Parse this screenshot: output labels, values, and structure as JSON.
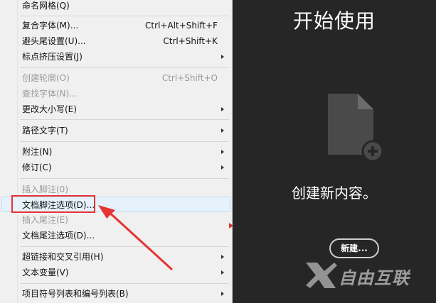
{
  "menu": {
    "items": [
      {
        "label": "命名网格(Q)",
        "shortcut": "",
        "submenu": false,
        "disabled": false
      },
      {
        "label": "复合字体(M)...",
        "shortcut": "Ctrl+Alt+Shift+F",
        "submenu": false,
        "disabled": false
      },
      {
        "label": "避头尾设置(U)...",
        "shortcut": "Ctrl+Shift+K",
        "submenu": false,
        "disabled": false
      },
      {
        "label": "标点挤压设置(J)",
        "shortcut": "",
        "submenu": true,
        "disabled": false
      },
      {
        "label": "创建轮廓(O)",
        "shortcut": "Ctrl+Shift+O",
        "submenu": false,
        "disabled": true
      },
      {
        "label": "查找字体(N)...",
        "shortcut": "",
        "submenu": false,
        "disabled": true
      },
      {
        "label": "更改大小写(E)",
        "shortcut": "",
        "submenu": true,
        "disabled": false
      },
      {
        "label": "路径文字(T)",
        "shortcut": "",
        "submenu": true,
        "disabled": false
      },
      {
        "label": "附注(N)",
        "shortcut": "",
        "submenu": true,
        "disabled": false
      },
      {
        "label": "修订(C)",
        "shortcut": "",
        "submenu": true,
        "disabled": false
      },
      {
        "label": "插入脚注(0)",
        "shortcut": "",
        "submenu": false,
        "disabled": true
      },
      {
        "label": "文档脚注选项(D)...",
        "shortcut": "",
        "submenu": false,
        "disabled": false,
        "highlighted": true
      },
      {
        "label": "插入尾注(E)",
        "shortcut": "",
        "submenu": false,
        "disabled": true
      },
      {
        "label": "文档尾注选项(D)...",
        "shortcut": "",
        "submenu": false,
        "disabled": false
      },
      {
        "label": "超链接和交叉引用(H)",
        "shortcut": "",
        "submenu": true,
        "disabled": false
      },
      {
        "label": "文本变量(V)",
        "shortcut": "",
        "submenu": true,
        "disabled": false
      },
      {
        "label": "项目符号列表和编号列表(B)",
        "shortcut": "",
        "submenu": true,
        "disabled": false
      }
    ]
  },
  "panel": {
    "title": "开始使用",
    "subtitle": "创建新内容。",
    "new_button": "新建..."
  },
  "watermark": {
    "text": "自由互联"
  },
  "colors": {
    "menu_bg": "#f0f0f0",
    "panel_bg": "#262626",
    "annotation_red": "#e63333",
    "highlight": "#e5f1fb"
  },
  "icons": {
    "document": "new-document-icon",
    "plus": "plus-circle-icon",
    "submenu": "submenu-arrow-icon",
    "watermark": "watermark-logo-icon"
  }
}
